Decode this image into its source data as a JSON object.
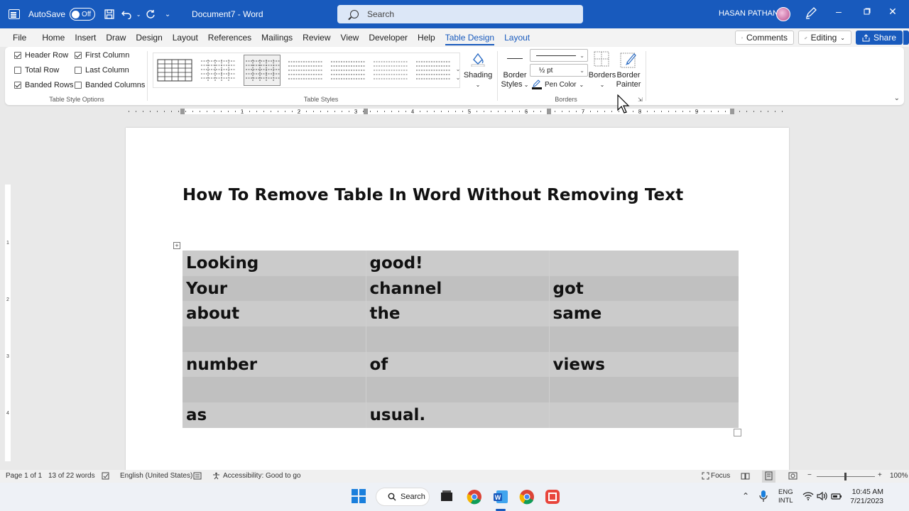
{
  "title_bar": {
    "autosave_label": "AutoSave",
    "autosave_state": "Off",
    "document_name": "Document7",
    "separator": "-",
    "app_name": "Word",
    "search_placeholder": "Search",
    "user_name": "HASAN PATHAN"
  },
  "menu": {
    "items": [
      "File",
      "Home",
      "Insert",
      "Draw",
      "Design",
      "Layout",
      "References",
      "Mailings",
      "Review",
      "View",
      "Developer",
      "Help",
      "Table Design",
      "Layout"
    ],
    "active": "Table Design",
    "comments_label": "Comments",
    "editing_label": "Editing",
    "share_label": "Share"
  },
  "ribbon": {
    "options": {
      "header_row": {
        "label": "Header Row",
        "checked": true
      },
      "first_column": {
        "label": "First Column",
        "checked": true
      },
      "total_row": {
        "label": "Total Row",
        "checked": false
      },
      "last_column": {
        "label": "Last Column",
        "checked": false
      },
      "banded_rows": {
        "label": "Banded Rows",
        "checked": true
      },
      "banded_columns": {
        "label": "Banded Columns",
        "checked": false
      }
    },
    "group_style_options": "Table Style Options",
    "group_table_styles": "Table Styles",
    "shading_label": "Shading",
    "border_styles_label_1": "Border",
    "border_styles_label_2": "Styles",
    "pen_weight": "½ pt",
    "pen_color_label": "Pen Color",
    "borders_label": "Borders",
    "border_painter_label_1": "Border",
    "border_painter_label_2": "Painter",
    "group_borders": "Borders"
  },
  "ruler_numbers": [
    "1",
    "2",
    "3",
    "4",
    "5",
    "6",
    "7",
    "8",
    "9"
  ],
  "vruler_numbers": [
    "1",
    "2",
    "3",
    "4"
  ],
  "document": {
    "heading": "How To Remove Table In Word Without Removing Text",
    "table": [
      [
        "Looking",
        "good!",
        ""
      ],
      [
        "Your",
        "channel",
        "got"
      ],
      [
        "about",
        "the",
        "same"
      ],
      [
        "",
        "",
        ""
      ],
      [
        "number",
        "of",
        "views"
      ],
      [
        "",
        "",
        ""
      ],
      [
        "as",
        "usual.",
        ""
      ]
    ]
  },
  "status_bar": {
    "page": "Page 1 of 1",
    "words": "13 of 22 words",
    "language": "English (United States)",
    "accessibility": "Accessibility: Good to go",
    "focus": "Focus",
    "zoom": "100%"
  },
  "taskbar": {
    "search_label": "Search",
    "lang_1": "ENG",
    "lang_2": "INTL",
    "time": "10:45 AM",
    "date": "7/21/2023"
  },
  "colors": {
    "brand_blue": "#185abd",
    "table_band_light": "#cbcbcb",
    "table_band_dark": "#c0c0c0"
  }
}
